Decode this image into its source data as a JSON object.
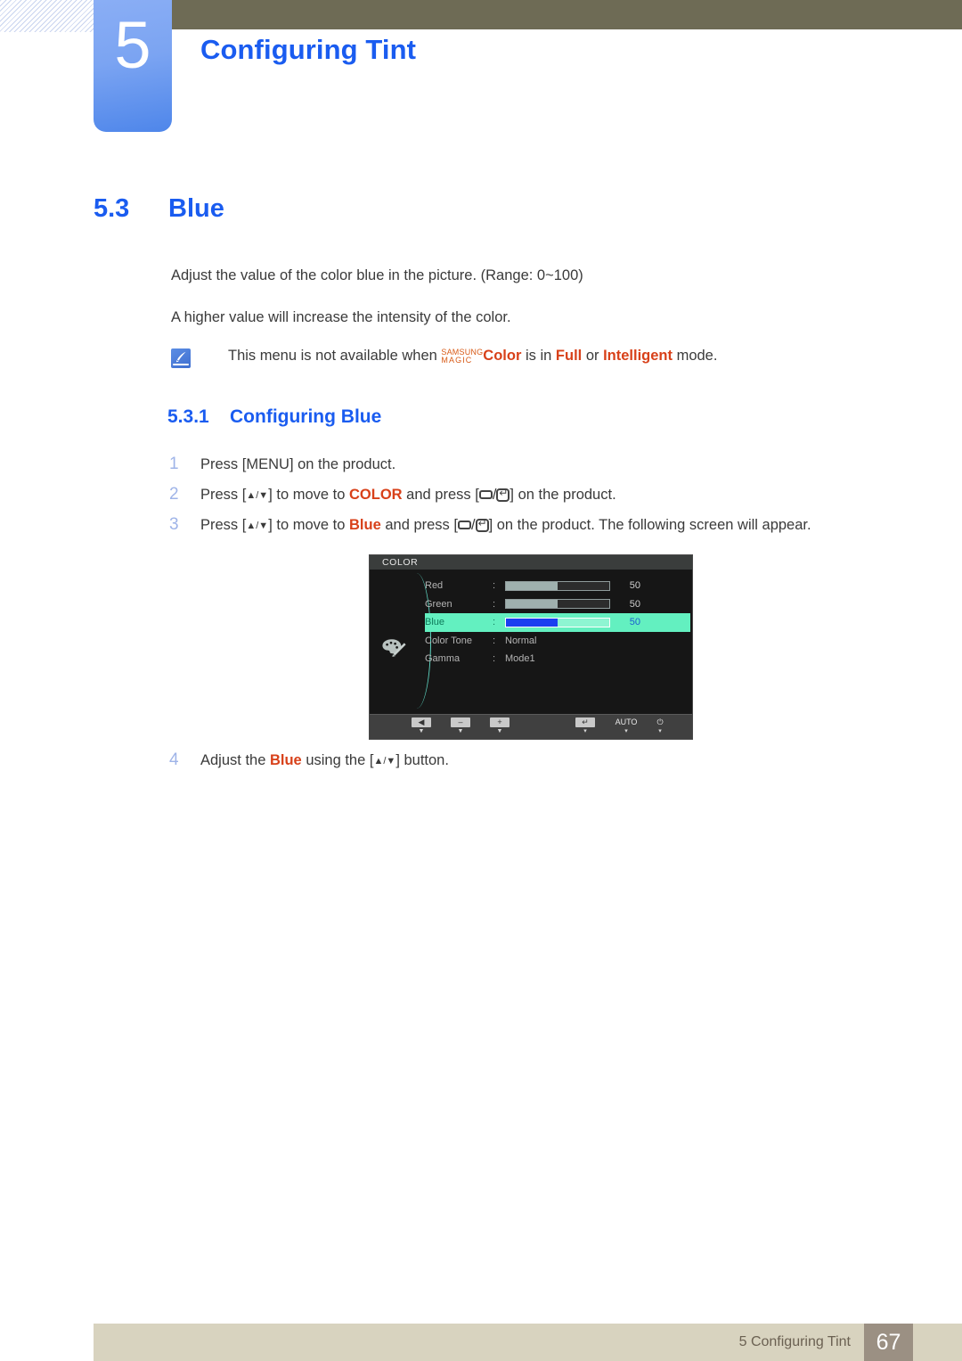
{
  "header": {
    "chapter_number": "5",
    "chapter_title": "Configuring Tint"
  },
  "section": {
    "number": "5.3",
    "title": "Blue"
  },
  "body": {
    "paragraph1": "Adjust the value of the color blue in the picture. (Range: 0~100)",
    "paragraph2": "A higher value will increase the intensity of the color."
  },
  "note": {
    "icon": "note-pen-icon",
    "text_before": "This menu is not available when ",
    "magic_line1": "SAMSUNG",
    "magic_line2": "MAGIC",
    "magic_suffix": "Color",
    "text_mid": " is in ",
    "mode1": "Full",
    "text_or": " or ",
    "mode2": "Intelligent",
    "text_after": " mode."
  },
  "subsection": {
    "number": "5.3.1",
    "title": "Configuring Blue"
  },
  "steps": [
    {
      "number": "1",
      "parts": [
        "Press [",
        "MENU",
        "] on the product."
      ]
    },
    {
      "number": "2",
      "prefix": "Press [",
      "arrows": "▲/▼",
      "mid1": "] to move to ",
      "highlight": "COLOR",
      "mid2": " and press [",
      "suffix": "] on the product."
    },
    {
      "number": "3",
      "prefix": "Press [",
      "arrows": "▲/▼",
      "mid1": "] to move to ",
      "highlight": "Blue",
      "mid2": " and press [",
      "suffix": "] on the product. The following screen will appear."
    },
    {
      "number": "4",
      "prefix": "Adjust the ",
      "highlight": "Blue",
      "mid1": " using the [",
      "arrows": "▲/▼",
      "suffix": "] button."
    }
  ],
  "osd": {
    "title": "COLOR",
    "icon": "palette-icon",
    "rows": [
      {
        "label": "Red",
        "colon": ":",
        "type": "slider",
        "value": "50",
        "percent": 50,
        "selected": false
      },
      {
        "label": "Green",
        "colon": ":",
        "type": "slider",
        "value": "50",
        "percent": 50,
        "selected": false
      },
      {
        "label": "Blue",
        "colon": ":",
        "type": "slider",
        "value": "50",
        "percent": 50,
        "selected": true
      },
      {
        "label": "Color Tone",
        "colon": ":",
        "type": "text",
        "value": "Normal",
        "selected": false
      },
      {
        "label": "Gamma",
        "colon": ":",
        "type": "text",
        "value": "Mode1",
        "selected": false
      }
    ],
    "footer_buttons": [
      {
        "name": "back-button",
        "glyph": "◀",
        "caption": "▼"
      },
      {
        "name": "minus-button",
        "glyph": "–",
        "caption": "▼"
      },
      {
        "name": "plus-button",
        "glyph": "+",
        "caption": "▼"
      },
      {
        "name": "enter-button",
        "glyph": "↵",
        "caption": "▾"
      },
      {
        "name": "auto-button",
        "glyph": "AUTO",
        "caption": "▾"
      },
      {
        "name": "power-button",
        "glyph": "⏻",
        "caption": "▾"
      }
    ]
  },
  "footer": {
    "text": "5 Configuring Tint",
    "page": "67"
  },
  "colors": {
    "accent_blue": "#1a5cf0",
    "orange": "#d8411a",
    "olive": "#6e6b55",
    "footer_bg": "#d8d3bf",
    "page_badge": "#9b9083",
    "osd_highlight": "#63f0c0"
  }
}
